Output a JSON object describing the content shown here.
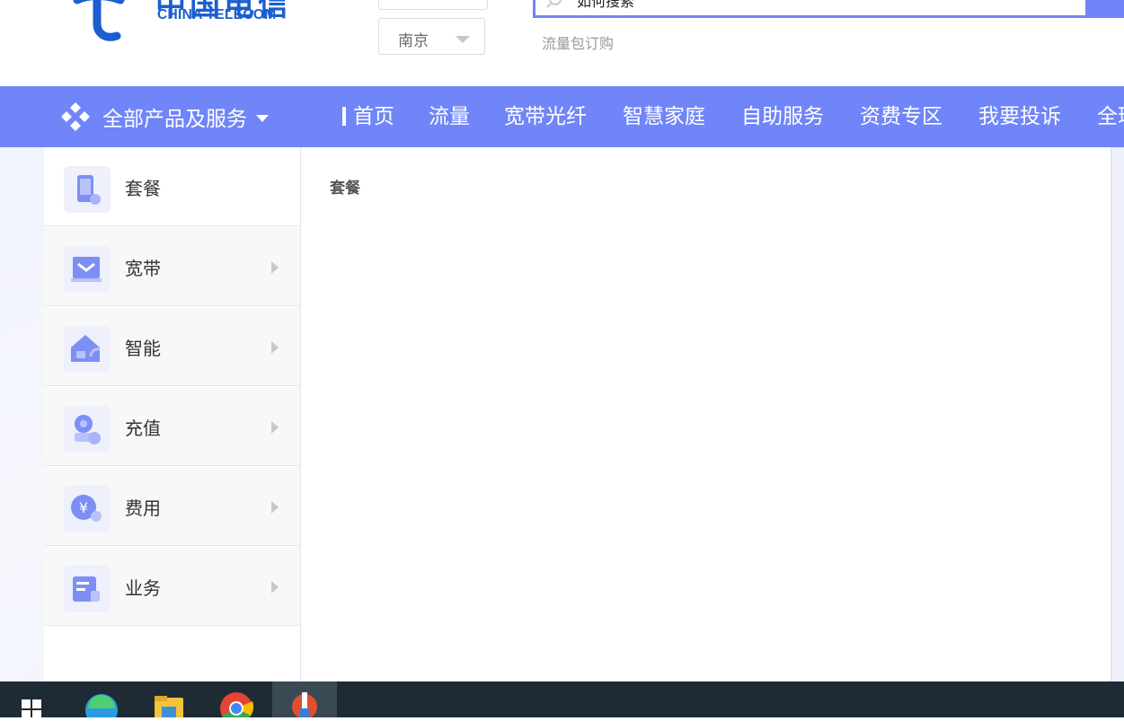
{
  "header": {
    "logo_cn": "中国电信",
    "logo_en": "CHINA TELECOM",
    "city_value": "南京",
    "search_text": "如何搜索",
    "hot_link": "流量包订购"
  },
  "nav": {
    "all_products": "全部产品及服务",
    "items": [
      "首页",
      "流量",
      "宽带光纤",
      "智慧家庭",
      "自助服务",
      "资费专区",
      "我要投诉",
      "全球"
    ]
  },
  "sidebar": {
    "items": [
      {
        "label": "套餐",
        "icon": "phone-icon"
      },
      {
        "label": "宽带",
        "icon": "broadband-icon"
      },
      {
        "label": "智能",
        "icon": "smart-home-icon"
      },
      {
        "label": "充值",
        "icon": "recharge-icon"
      },
      {
        "label": "费用",
        "icon": "fee-icon"
      },
      {
        "label": "业务",
        "icon": "business-icon"
      }
    ]
  },
  "panel": {
    "title": "套餐"
  },
  "taskbar": {
    "items": [
      "windows-start-icon",
      "edge-browser-icon",
      "file-explorer-icon",
      "chrome-browser-icon",
      "app-icon"
    ]
  },
  "colors": {
    "brand_blue": "#6f85f8",
    "logo_blue": "#1a5fd0",
    "taskbar": "#1e2b35"
  }
}
